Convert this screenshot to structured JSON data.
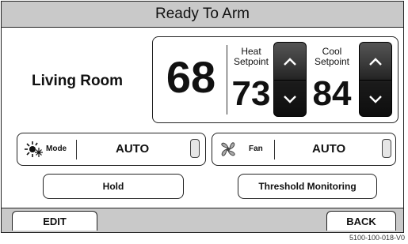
{
  "header": {
    "title": "Ready To Arm"
  },
  "room": {
    "name": "Living Room"
  },
  "temperature": {
    "current": "68",
    "heat": {
      "label_line1": "Heat",
      "label_line2": "Setpoint",
      "value": "73"
    },
    "cool": {
      "label_line1": "Cool",
      "label_line2": "Setpoint",
      "value": "84"
    }
  },
  "mode": {
    "label": "Mode",
    "value": "AUTO",
    "icon": "sun-snowflake-icon"
  },
  "fan": {
    "label": "Fan",
    "value": "AUTO",
    "icon": "fan-icon"
  },
  "buttons": {
    "hold": "Hold",
    "threshold": "Threshold Monitoring"
  },
  "footer": {
    "edit": "EDIT",
    "back": "BACK"
  },
  "figure_id": "5100-100-018-V0",
  "colors": {
    "bars": "#c9c9c9",
    "stepper": "#1a1a1a",
    "border": "#222222"
  }
}
